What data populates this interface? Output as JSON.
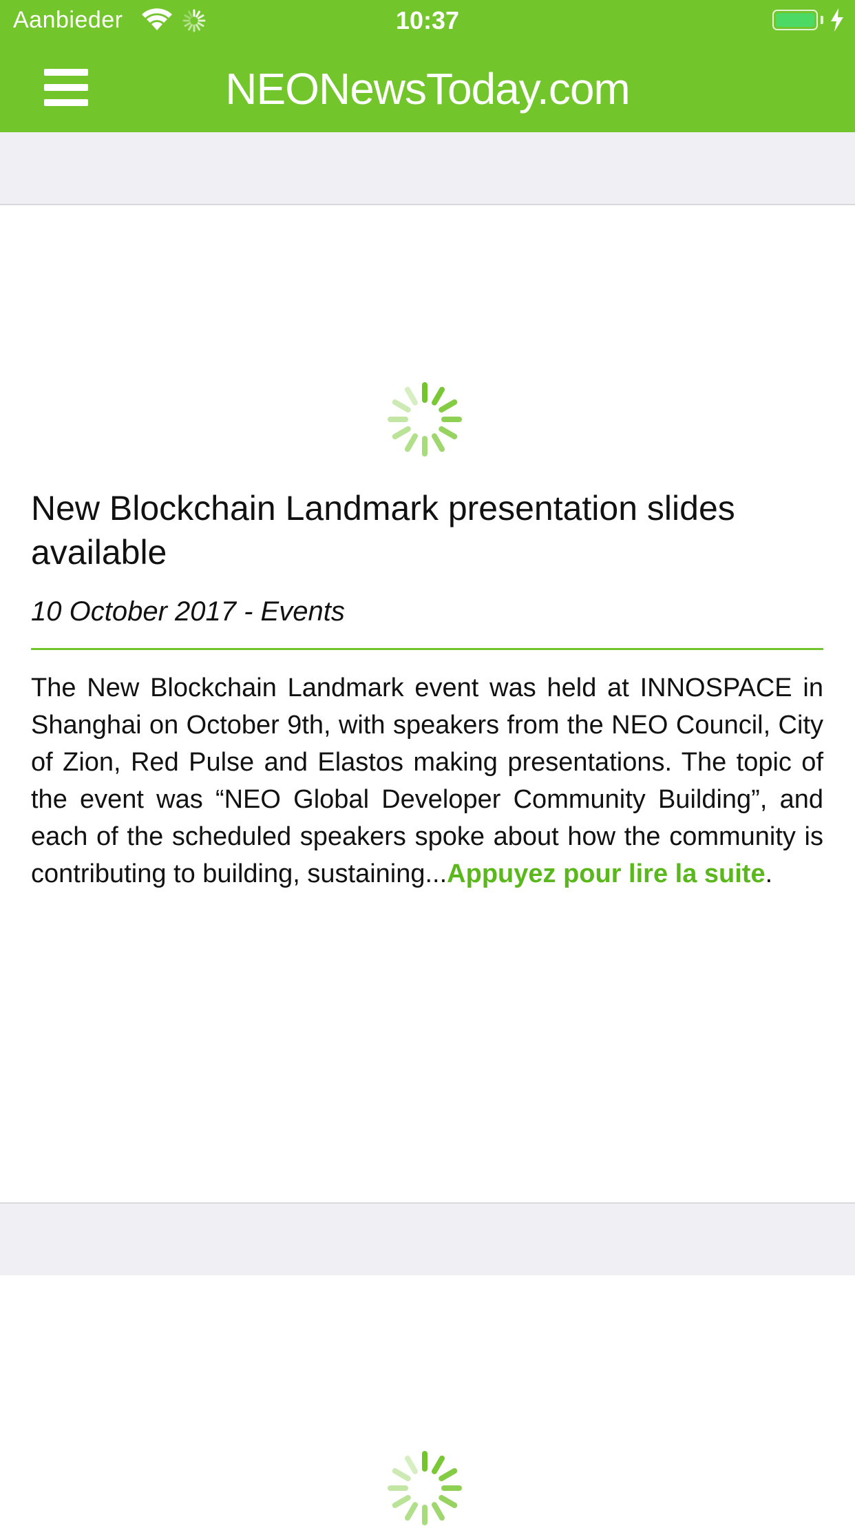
{
  "status_bar": {
    "carrier": "Aanbieder",
    "time": "10:37",
    "battery_color": "#4cd964"
  },
  "nav": {
    "title": "NEONewsToday.com",
    "menu_icon": "hamburger-menu-icon",
    "accent_color": "#72c52a"
  },
  "articles": [
    {
      "title": "New Blockchain Landmark presentation slides available",
      "date": "10 October 2017",
      "separator": " - ",
      "category": "Events",
      "excerpt": "The New Blockchain Landmark event was held at INNOSPACE in Shanghai on October 9th, with speakers from the NEO Council, City of Zion, Red Pulse and Elastos making presentations. The topic of the event was “NEO Global Developer Community Building”, and each of the scheduled speakers spoke about how the community is contributing to building, sustaining...",
      "read_more": "Appuyez pour lire la suite",
      "read_more_suffix": ".",
      "image_state": "loading-spinner-icon"
    }
  ],
  "next_article": {
    "image_state": "loading-spinner-icon"
  }
}
